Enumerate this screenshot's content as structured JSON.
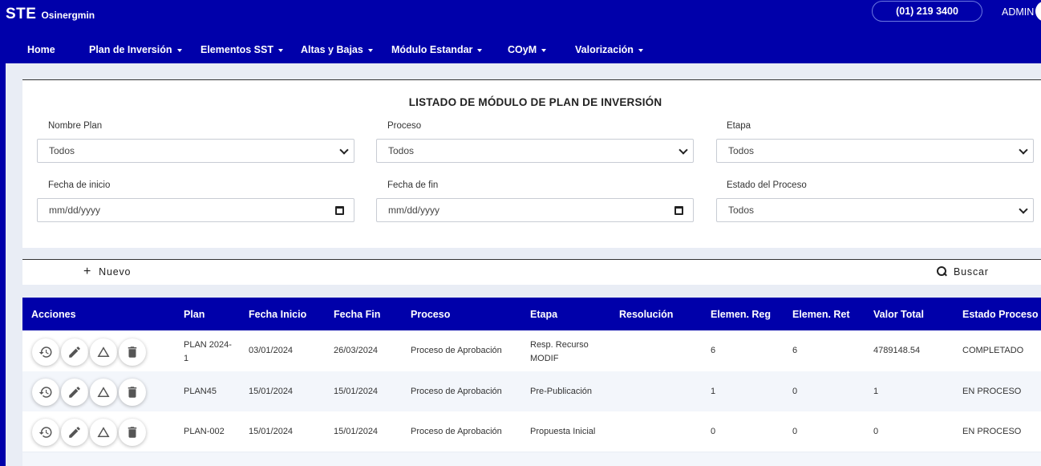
{
  "header": {
    "brand": "STE",
    "org": "Osinergmin",
    "phone": "(01) 219 3400",
    "user": "ADMIN"
  },
  "nav": [
    {
      "label": "Home",
      "dropdown": false
    },
    {
      "label": "Plan de Inversión",
      "dropdown": true
    },
    {
      "label": "Elementos SST",
      "dropdown": true
    },
    {
      "label": "Altas y Bajas",
      "dropdown": true
    },
    {
      "label": "Módulo Estandar",
      "dropdown": true
    },
    {
      "label": "COyM",
      "dropdown": true
    },
    {
      "label": "Valorización",
      "dropdown": true
    }
  ],
  "filters": {
    "title": "LISTADO DE MÓDULO DE PLAN DE INVERSIÓN",
    "fields": [
      {
        "label": "Nombre Plan",
        "value": "Todos",
        "type": "select"
      },
      {
        "label": "Proceso",
        "value": "Todos",
        "type": "select"
      },
      {
        "label": "Etapa",
        "value": "Todos",
        "type": "select"
      },
      {
        "label": "Fecha de inicio",
        "value": "mm/dd/yyyy",
        "type": "date"
      },
      {
        "label": "Fecha de fin",
        "value": "mm/dd/yyyy",
        "type": "date"
      },
      {
        "label": "Estado del Proceso",
        "value": "Todos",
        "type": "select"
      }
    ]
  },
  "actions": {
    "new_label": "Nuevo",
    "search_label": "Buscar"
  },
  "table": {
    "columns": [
      "Acciones",
      "Plan",
      "Fecha Inicio",
      "Fecha Fin",
      "Proceso",
      "Etapa",
      "Resolución",
      "Elemen. Reg",
      "Elemen. Ret",
      "Valor Total",
      "Estado Proceso"
    ],
    "row_icons": [
      "history-icon",
      "edit-icon",
      "warning-icon",
      "delete-icon"
    ],
    "rows": [
      {
        "plan": [
          "PLAN 2024-",
          "1"
        ],
        "fecha_inicio": "03/01/2024",
        "fecha_fin": "26/03/2024",
        "proceso": "Proceso de Aprobación",
        "etapa": [
          "Resp. Recurso",
          "MODIF"
        ],
        "resolucion": "",
        "reg": "6",
        "ret": "6",
        "valor": "4789148.54",
        "estado": "COMPLETADO"
      },
      {
        "plan": [
          "PLAN45"
        ],
        "fecha_inicio": "15/01/2024",
        "fecha_fin": "15/01/2024",
        "proceso": "Proceso de Aprobación",
        "etapa": [
          "Pre-Publicación"
        ],
        "resolucion": "",
        "reg": "1",
        "ret": "0",
        "valor": "1",
        "estado": "EN PROCESO"
      },
      {
        "plan": [
          "PLAN-002"
        ],
        "fecha_inicio": "15/01/2024",
        "fecha_fin": "15/01/2024",
        "proceso": "Proceso de Aprobación",
        "etapa": [
          "Propuesta Inicial"
        ],
        "resolucion": "",
        "reg": "0",
        "ret": "0",
        "valor": "0",
        "estado": "EN PROCESO"
      }
    ]
  }
}
